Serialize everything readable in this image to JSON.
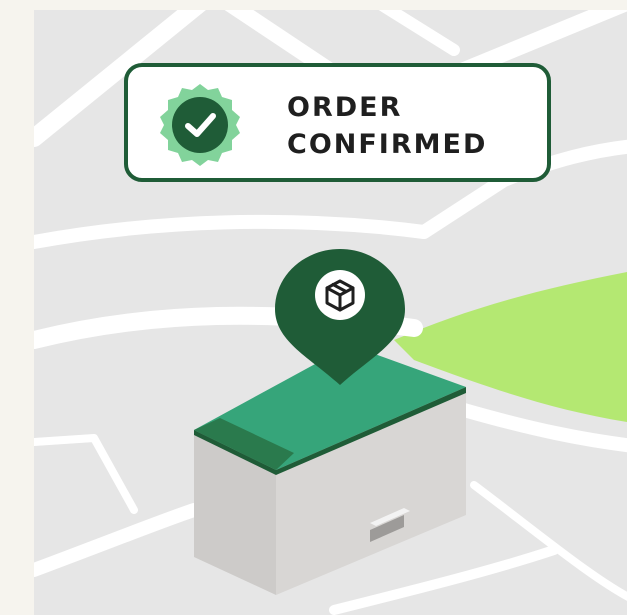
{
  "badge": {
    "line1": "ORDER",
    "line2": "CONFIRMED",
    "icon": "check-seal-icon"
  },
  "pin": {
    "icon": "package-box-icon"
  },
  "colors": {
    "background": "#f6f4ee",
    "map": "#e6e6e6",
    "road": "#ffffff",
    "park": "#b4e872",
    "dark_green": "#1f5c37",
    "roof_green": "#36a57a",
    "seal_light": "#82d39b",
    "building_front": "#cdcbc9",
    "building_side": "#9d9b99"
  }
}
